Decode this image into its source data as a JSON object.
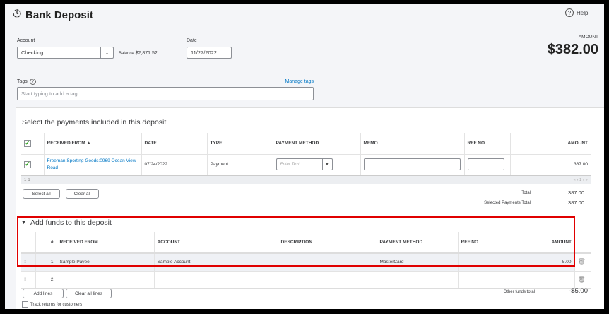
{
  "header": {
    "title": "Bank Deposit",
    "help": "Help",
    "icon": "history-icon"
  },
  "form": {
    "account_label": "Account",
    "account_value": "Checking",
    "balance_label": "Balance",
    "balance_value": "$2,871.52",
    "date_label": "Date",
    "date_value": "11/27/2022",
    "amount_label": "AMOUNT",
    "amount_value": "$382.00",
    "tags_label": "Tags",
    "manage_tags": "Manage tags",
    "tags_placeholder": "Start typing to add a tag"
  },
  "payments": {
    "heading": "Select the payments included in this deposit",
    "columns": [
      "RECEIVED FROM ▲",
      "DATE",
      "TYPE",
      "PAYMENT METHOD",
      "MEMO",
      "REF NO.",
      "AMOUNT"
    ],
    "rows": [
      {
        "checked": true,
        "received_from": "Freeman Sporting Goods:0969 Ocean View Road",
        "date": "07/24/2022",
        "type": "Payment",
        "payment_method_placeholder": "Enter Text",
        "memo": "",
        "ref_no": "",
        "amount": "387.00"
      }
    ],
    "range": "1-1",
    "pager": "« ‹ 1 › »",
    "select_all": "Select all",
    "clear_all": "Clear all",
    "total_label": "Total",
    "total_value": "387.00",
    "selected_total_label": "Selected Payments Total",
    "selected_total_value": "387.00"
  },
  "funds": {
    "heading": "Add funds to this deposit",
    "columns": [
      "#",
      "RECEIVED FROM",
      "ACCOUNT",
      "DESCRIPTION",
      "PAYMENT METHOD",
      "REF NO.",
      "AMOUNT"
    ],
    "rows": [
      {
        "num": "1",
        "received_from": "Sample Payee",
        "account": "Sample Account",
        "description": "",
        "payment_method": "MasterCard",
        "ref_no": "",
        "amount": "-5.00"
      },
      {
        "num": "2",
        "received_from": "",
        "account": "",
        "description": "",
        "payment_method": "",
        "ref_no": "",
        "amount": ""
      }
    ],
    "add_lines": "Add lines",
    "clear_all_lines": "Clear all lines",
    "other_total_label": "Other funds total",
    "other_total_value": "-$5.00",
    "track_returns": "Track returns for customers",
    "highlight_color": "#e00000"
  }
}
